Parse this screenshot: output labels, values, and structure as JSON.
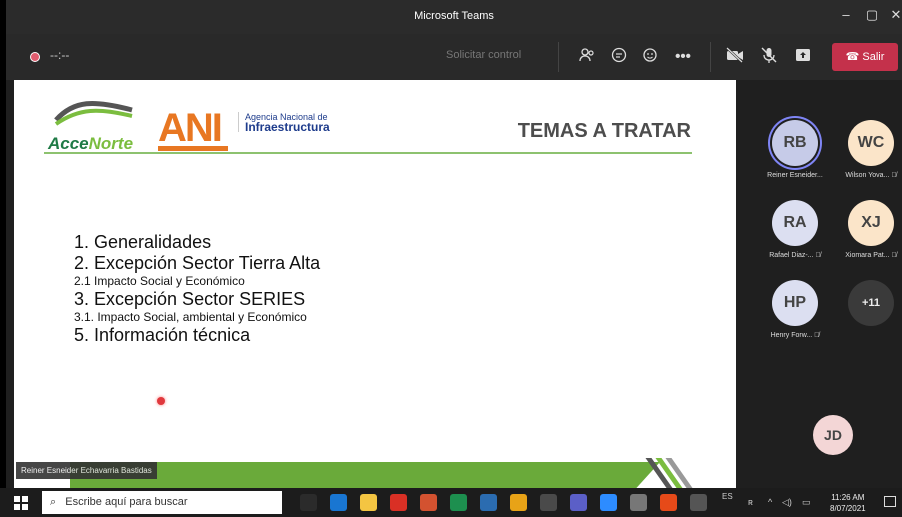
{
  "window": {
    "title": "Microsoft Teams",
    "minimize": "–",
    "maximize": "▢",
    "close": "✕"
  },
  "callbar": {
    "timer": "--:--",
    "request_control": "Solicitar control",
    "leave_label": "Salir",
    "icons": [
      "participants-icon",
      "chat-icon",
      "reactions-icon",
      "more-icon",
      "camera-off-icon",
      "mic-off-icon",
      "share-icon"
    ]
  },
  "slide": {
    "logo_acce": "Acce",
    "logo_norte": "Norte",
    "ani": "ANI",
    "agency_line1": "Agencia Nacional de",
    "agency_line2": "Infraestructura",
    "title": "TEMAS A TRATAR",
    "agenda": [
      {
        "text": "1. Generalidades",
        "size": "big"
      },
      {
        "text": "2. Excepción Sector Tierra Alta",
        "size": "big"
      },
      {
        "text": "2.1 Impacto Social y Económico",
        "size": "small"
      },
      {
        "text": "3. Excepción Sector SERIES",
        "size": "big"
      },
      {
        "text": "3.1. Impacto Social, ambiental y Económico",
        "size": "small"
      },
      {
        "text": "5. Información técnica",
        "size": "big"
      }
    ],
    "presenter": "Reiner Esneider Echavarria Bastidas"
  },
  "participants": [
    {
      "initials": "RB",
      "name": "Reiner Esneider...",
      "color": "#c6cbe8",
      "muted": false,
      "active": true
    },
    {
      "initials": "WC",
      "name": "Wilson Yova...",
      "color": "#fbe5c9",
      "muted": true,
      "active": false
    },
    {
      "initials": "RA",
      "name": "Rafael Diaz-...",
      "color": "#dcdff1",
      "muted": true,
      "active": false
    },
    {
      "initials": "XJ",
      "name": "Xiomara Pat...",
      "color": "#fbe5c9",
      "muted": true,
      "active": false
    },
    {
      "initials": "HP",
      "name": "Henry Forw...",
      "color": "#dcdff1",
      "muted": true,
      "active": false
    }
  ],
  "overflow_label": "+11",
  "self_initials": "JD",
  "taskbar": {
    "search_placeholder": "Escribe aquí para buscar",
    "lang": "ES",
    "time": "11:26 AM",
    "date": "8/07/2021"
  }
}
